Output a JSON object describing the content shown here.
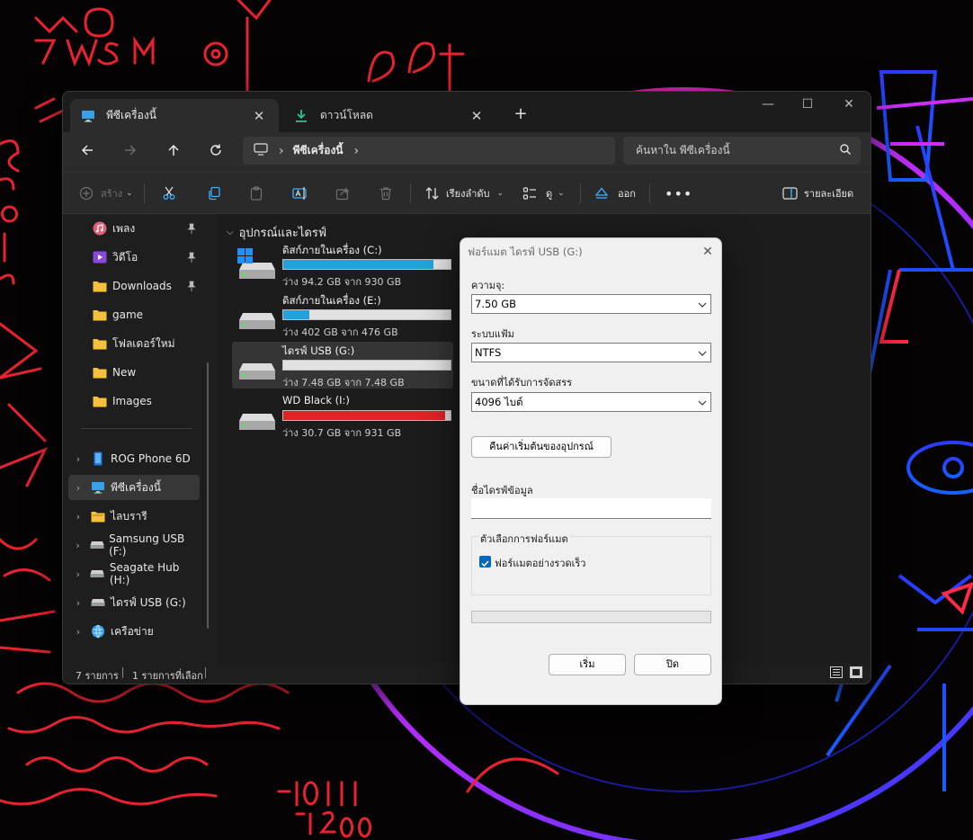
{
  "explorer": {
    "tabs": [
      {
        "label": "พีซีเครื่องนี้",
        "icon": "monitor-icon",
        "active": true
      },
      {
        "label": "ดาวน์โหลด",
        "icon": "download-icon",
        "active": false
      }
    ],
    "breadcrumb": [
      "พีซีเครื่องนี้"
    ],
    "search_placeholder": "ค้นหาใน พีซีเครื่องนี้",
    "toolbar": {
      "new_label": "สร้าง",
      "sort_label": "เรียงลำดับ",
      "view_label": "ดู",
      "eject_label": "ออก",
      "details_label": "รายละเอียด"
    },
    "sidebar": {
      "quick_access": [
        {
          "label": "เพลง",
          "icon": "music-icon",
          "pinned": true
        },
        {
          "label": "วิดีโอ",
          "icon": "video-icon",
          "pinned": true
        },
        {
          "label": "Downloads",
          "icon": "folder-icon",
          "pinned": true
        },
        {
          "label": "game",
          "icon": "folder-icon",
          "pinned": false
        },
        {
          "label": "โฟลเดอร์ใหม่",
          "icon": "folder-icon",
          "pinned": false
        },
        {
          "label": "New",
          "icon": "folder-icon",
          "pinned": false
        },
        {
          "label": "Images",
          "icon": "folder-icon",
          "pinned": false
        }
      ],
      "tree": [
        {
          "label": "ROG Phone 6D",
          "icon": "phone-icon"
        },
        {
          "label": "พีซีเครื่องนี้",
          "icon": "monitor-icon",
          "selected": true
        },
        {
          "label": "ไลบรารี",
          "icon": "library-folder-icon"
        },
        {
          "label": "Samsung USB (F:)",
          "icon": "drive-icon"
        },
        {
          "label": "Seagate Hub (H:)",
          "icon": "drive-icon"
        },
        {
          "label": "ไดรฟ์ USB (G:)",
          "icon": "drive-icon"
        },
        {
          "label": "เครือข่าย",
          "icon": "network-icon"
        }
      ]
    },
    "content": {
      "group_title": "อุปกรณ์และไดรฟ์",
      "drives": [
        {
          "name": "ดิสก์ภายในเครื่อง (C:)",
          "info": "ว่าง 94.2 GB จาก 930 GB",
          "used_fraction": 0.899,
          "icon": "windows-drive-icon"
        },
        {
          "name": "ดิสก์ภายในเครื่อง (E:)",
          "info": "ว่าง 402 GB จาก 476 GB",
          "used_fraction": 0.155,
          "icon": "drive-icon"
        },
        {
          "name": "ไดรฟ์ USB (G:)",
          "info": "ว่าง 7.48 GB จาก 7.48 GB",
          "used_fraction": 0.0,
          "icon": "drive-icon",
          "selected": true
        },
        {
          "name": "WD Black (I:)",
          "info": "ว่าง 30.7 GB จาก 931 GB",
          "used_fraction": 0.967,
          "icon": "drive-icon",
          "low_space": true
        }
      ]
    },
    "status": {
      "item_count": "7 รายการ",
      "selected_count": "1 รายการที่เลือก"
    }
  },
  "format_dialog": {
    "title": "ฟอร์แมต ไดรฟ์ USB (G:)",
    "capacity_label": "ความจุ:",
    "capacity_value": "7.50 GB",
    "filesystem_label": "ระบบแฟ้ม",
    "filesystem_value": "NTFS",
    "allocation_label": "ขนาดที่ได้รับการจัดสรร",
    "allocation_value": "4096 ไบต์",
    "restore_defaults_label": "คืนค่าเริ่มต้นของอุปกรณ์",
    "volume_label_label": "ชื่อไดรฟ์ข้อมูล",
    "volume_label_value": "",
    "options_label": "ตัวเลือกการฟอร์แมต",
    "quick_format_label": "ฟอร์แมตอย่างรวดเร็ว",
    "quick_format_checked": true,
    "progress_fraction": 0,
    "start_label": "เริ่ม",
    "close_label": "ปิด"
  }
}
